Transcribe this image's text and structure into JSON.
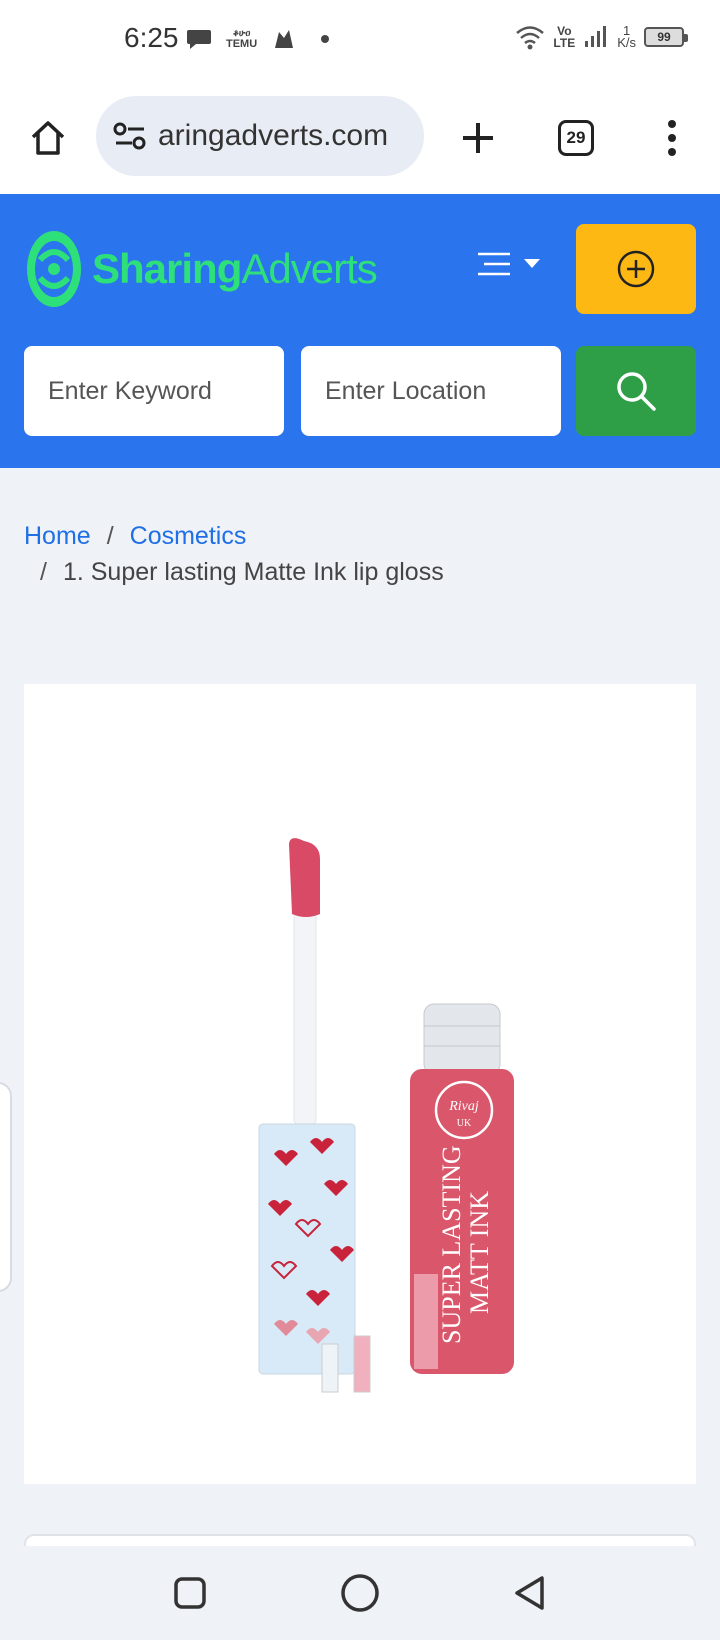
{
  "status": {
    "time": "6:25",
    "temu_label": "TEMU",
    "temu_top": "ቆሁዐ",
    "volte": "Vo\nLTE",
    "speed_num": "1",
    "speed_unit": "K/s",
    "battery": "99"
  },
  "browser": {
    "url": "aringadverts.com",
    "tab_count": "29"
  },
  "header": {
    "logo_part1": "Sharing",
    "logo_part2": "Adverts",
    "keyword_placeholder": "Enter Keyword",
    "location_placeholder": "Enter Location",
    "brand_color": "#2a74ee",
    "post_color": "#fdb813",
    "search_color": "#2e9f46"
  },
  "breadcrumb": {
    "home": "Home",
    "category": "Cosmetics",
    "separator": "/",
    "current": "1. Super lasting Matte Ink lip gloss"
  },
  "product": {
    "tube_text_line1": "SUPER LASTING",
    "tube_text_line2": "MATT INK",
    "badge_text": "Rivaj",
    "badge_sub": "UK"
  }
}
